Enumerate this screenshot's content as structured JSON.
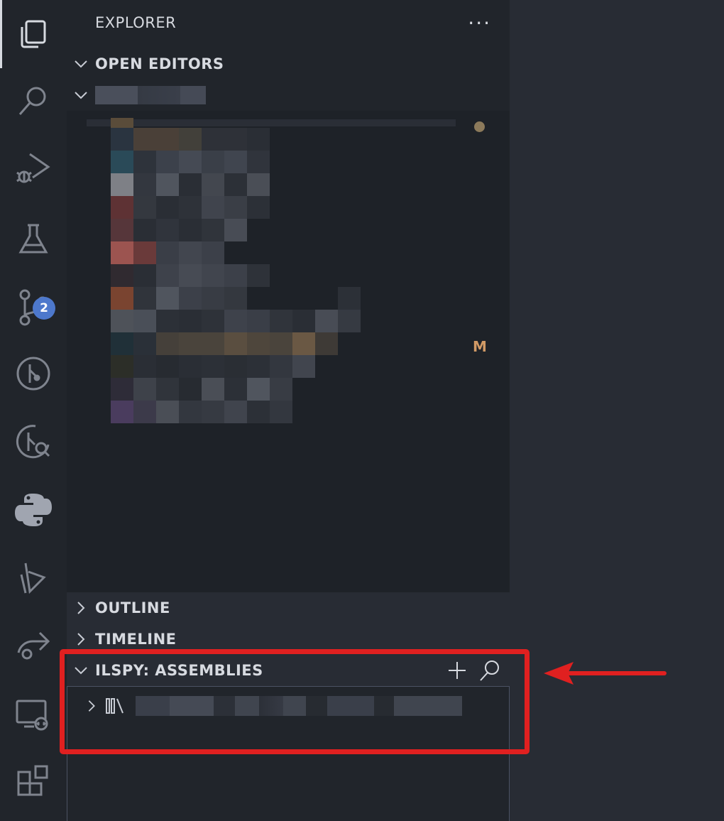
{
  "activity_bar": {
    "items": [
      {
        "icon": "files-icon",
        "active": true
      },
      {
        "icon": "search-icon"
      },
      {
        "icon": "run-debug-icon"
      },
      {
        "icon": "testing-icon"
      },
      {
        "icon": "source-control-icon",
        "badge": "2"
      },
      {
        "icon": "git-graph-icon"
      },
      {
        "icon": "git-lens-icon"
      },
      {
        "icon": "python-icon"
      },
      {
        "icon": "powershell-icon"
      },
      {
        "icon": "live-share-icon"
      },
      {
        "icon": "remote-explorer-icon"
      },
      {
        "icon": "extensions-icon"
      }
    ]
  },
  "sidebar": {
    "title": "EXPLORER",
    "more_label": "···",
    "sections": {
      "open_editors": "OPEN EDITORS",
      "outline": "OUTLINE",
      "timeline": "TIMELINE",
      "ilspy": "ILSPY: ASSEMBLIES"
    },
    "file_status": "M"
  },
  "colors": {
    "accent": "#4d78cc",
    "annotation": "#e02020",
    "modified": "#d19a66"
  }
}
